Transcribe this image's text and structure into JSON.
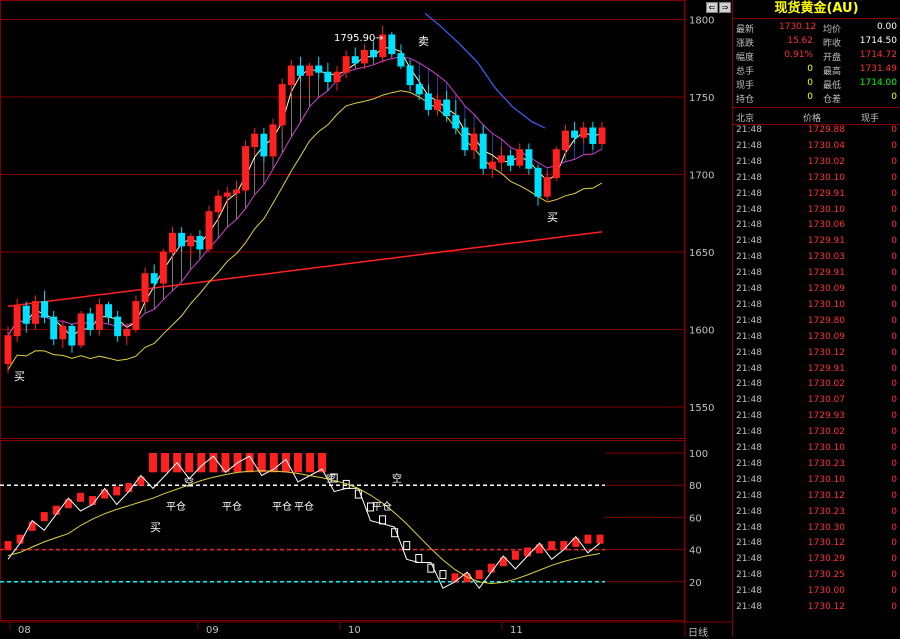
{
  "instrument_title": "现货黄金(AU)",
  "nav": {
    "prev_icon": "arrow-left-icon",
    "next_icon": "arrow-right-icon"
  },
  "quote": {
    "latest_label": "最新",
    "latest": "1730.12",
    "avg_label": "均价",
    "avg": "0.00",
    "change_label": "涨跌",
    "change": "15.62",
    "prev_close_label": "昨收",
    "prev_close": "1714.50",
    "amplitude_label": "幅度",
    "amplitude": "0.91%",
    "open_label": "开盘",
    "open": "1714.72",
    "total_label": "总手",
    "total": "0",
    "high_label": "最高",
    "high": "1731.49",
    "current_label": "现手",
    "current": "0",
    "low_label": "最低",
    "low": "1714.00",
    "hold_label": "持仓",
    "hold": "0",
    "hold_diff_label": "仓差",
    "hold_diff": "0"
  },
  "ticks_header": {
    "time": "北京",
    "price": "价格",
    "vol": "现手"
  },
  "ticks": [
    {
      "t": "21:48",
      "p": "1729.88",
      "v": "0"
    },
    {
      "t": "21:48",
      "p": "1730.04",
      "v": "0"
    },
    {
      "t": "21:48",
      "p": "1730.02",
      "v": "0"
    },
    {
      "t": "21:48",
      "p": "1730.10",
      "v": "0"
    },
    {
      "t": "21:48",
      "p": "1729.91",
      "v": "0"
    },
    {
      "t": "21:48",
      "p": "1730.10",
      "v": "0"
    },
    {
      "t": "21:48",
      "p": "1730.06",
      "v": "0"
    },
    {
      "t": "21:48",
      "p": "1729.91",
      "v": "0"
    },
    {
      "t": "21:48",
      "p": "1730.03",
      "v": "0"
    },
    {
      "t": "21:48",
      "p": "1729.91",
      "v": "0"
    },
    {
      "t": "21:48",
      "p": "1730.09",
      "v": "0"
    },
    {
      "t": "21:48",
      "p": "1730.10",
      "v": "0"
    },
    {
      "t": "21:48",
      "p": "1729.80",
      "v": "0"
    },
    {
      "t": "21:48",
      "p": "1730.09",
      "v": "0"
    },
    {
      "t": "21:48",
      "p": "1730.12",
      "v": "0"
    },
    {
      "t": "21:48",
      "p": "1729.91",
      "v": "0"
    },
    {
      "t": "21:48",
      "p": "1730.02",
      "v": "0"
    },
    {
      "t": "21:48",
      "p": "1730.07",
      "v": "0"
    },
    {
      "t": "21:48",
      "p": "1729.93",
      "v": "0"
    },
    {
      "t": "21:48",
      "p": "1730.02",
      "v": "0"
    },
    {
      "t": "21:48",
      "p": "1730.10",
      "v": "0"
    },
    {
      "t": "21:48",
      "p": "1730.23",
      "v": "0"
    },
    {
      "t": "21:48",
      "p": "1730.10",
      "v": "0"
    },
    {
      "t": "21:48",
      "p": "1730.12",
      "v": "0"
    },
    {
      "t": "21:48",
      "p": "1730.23",
      "v": "0"
    },
    {
      "t": "21:48",
      "p": "1730.30",
      "v": "0"
    },
    {
      "t": "21:48",
      "p": "1730.12",
      "v": "0"
    },
    {
      "t": "21:48",
      "p": "1730.29",
      "v": "0"
    },
    {
      "t": "21:48",
      "p": "1730.25",
      "v": "0"
    },
    {
      "t": "21:48",
      "p": "1730.00",
      "v": "0"
    },
    {
      "t": "21:48",
      "p": "1730.12",
      "v": "0"
    }
  ],
  "chart": {
    "price_ticks": [
      "1800",
      "1750",
      "1700",
      "1650",
      "1600",
      "1550"
    ],
    "osc_ticks": [
      "100",
      "80",
      "60",
      "40",
      "20"
    ],
    "date_labels": [
      "08",
      "09",
      "10",
      "11"
    ],
    "period_label": "日线",
    "peak_label": "1795.90",
    "buy_label": "买",
    "sell_label": "卖",
    "close_label": "平仓",
    "empty_label": "空",
    "many_label": "多"
  },
  "chart_data": {
    "type": "candlestick",
    "price_range": [
      1530,
      1810
    ],
    "oscillator_range": [
      0,
      100
    ],
    "candles": [
      [
        1578,
        1602,
        1572,
        1596
      ],
      [
        1596,
        1620,
        1592,
        1615
      ],
      [
        1615,
        1618,
        1598,
        1604
      ],
      [
        1604,
        1622,
        1600,
        1618
      ],
      [
        1618,
        1625,
        1604,
        1608
      ],
      [
        1608,
        1612,
        1590,
        1594
      ],
      [
        1594,
        1606,
        1588,
        1602
      ],
      [
        1602,
        1604,
        1585,
        1590
      ],
      [
        1590,
        1612,
        1588,
        1610
      ],
      [
        1610,
        1614,
        1596,
        1600
      ],
      [
        1600,
        1620,
        1596,
        1616
      ],
      [
        1616,
        1618,
        1604,
        1608
      ],
      [
        1608,
        1612,
        1592,
        1596
      ],
      [
        1596,
        1604,
        1590,
        1600
      ],
      [
        1600,
        1622,
        1598,
        1618
      ],
      [
        1618,
        1640,
        1614,
        1636
      ],
      [
        1636,
        1642,
        1626,
        1630
      ],
      [
        1630,
        1652,
        1628,
        1650
      ],
      [
        1650,
        1666,
        1646,
        1662
      ],
      [
        1662,
        1666,
        1650,
        1654
      ],
      [
        1654,
        1662,
        1646,
        1660
      ],
      [
        1660,
        1664,
        1648,
        1652
      ],
      [
        1652,
        1680,
        1650,
        1676
      ],
      [
        1676,
        1690,
        1670,
        1686
      ],
      [
        1686,
        1692,
        1680,
        1688
      ],
      [
        1688,
        1696,
        1684,
        1690
      ],
      [
        1690,
        1722,
        1688,
        1718
      ],
      [
        1718,
        1730,
        1712,
        1726
      ],
      [
        1726,
        1730,
        1708,
        1712
      ],
      [
        1712,
        1736,
        1710,
        1732
      ],
      [
        1732,
        1762,
        1728,
        1758
      ],
      [
        1758,
        1774,
        1752,
        1770
      ],
      [
        1770,
        1776,
        1760,
        1764
      ],
      [
        1764,
        1772,
        1756,
        1770
      ],
      [
        1770,
        1776,
        1762,
        1766
      ],
      [
        1766,
        1772,
        1754,
        1760
      ],
      [
        1760,
        1770,
        1754,
        1766
      ],
      [
        1766,
        1780,
        1762,
        1776
      ],
      [
        1776,
        1782,
        1770,
        1772
      ],
      [
        1772,
        1784,
        1768,
        1780
      ],
      [
        1780,
        1786,
        1774,
        1776
      ],
      [
        1776,
        1796,
        1772,
        1790
      ],
      [
        1790,
        1792,
        1776,
        1778
      ],
      [
        1778,
        1784,
        1768,
        1770
      ],
      [
        1770,
        1774,
        1754,
        1758
      ],
      [
        1758,
        1764,
        1748,
        1752
      ],
      [
        1752,
        1758,
        1738,
        1742
      ],
      [
        1742,
        1752,
        1738,
        1748
      ],
      [
        1748,
        1754,
        1734,
        1738
      ],
      [
        1738,
        1748,
        1726,
        1730
      ],
      [
        1730,
        1736,
        1712,
        1716
      ],
      [
        1716,
        1730,
        1710,
        1726
      ],
      [
        1726,
        1732,
        1700,
        1704
      ],
      [
        1704,
        1712,
        1698,
        1708
      ],
      [
        1708,
        1718,
        1702,
        1712
      ],
      [
        1712,
        1716,
        1702,
        1706
      ],
      [
        1706,
        1720,
        1704,
        1716
      ],
      [
        1716,
        1720,
        1700,
        1704
      ],
      [
        1704,
        1706,
        1680,
        1686
      ],
      [
        1686,
        1702,
        1682,
        1698
      ],
      [
        1698,
        1718,
        1696,
        1716
      ],
      [
        1716,
        1732,
        1712,
        1728
      ],
      [
        1728,
        1734,
        1720,
        1724
      ],
      [
        1724,
        1734,
        1720,
        1730
      ],
      [
        1730,
        1734,
        1716,
        1720
      ],
      [
        1720,
        1734,
        1718,
        1730
      ]
    ],
    "oscillator": [
      40,
      44,
      52,
      58,
      62,
      66,
      70,
      68,
      72,
      74,
      76,
      80,
      84,
      86,
      88,
      90,
      92,
      92,
      94,
      94,
      92,
      92,
      90,
      90,
      88,
      86,
      84,
      82,
      78,
      72,
      64,
      56,
      48,
      40,
      32,
      26,
      22,
      20,
      20,
      22,
      26,
      30,
      34,
      36,
      38,
      40,
      40,
      42,
      44,
      44
    ]
  }
}
